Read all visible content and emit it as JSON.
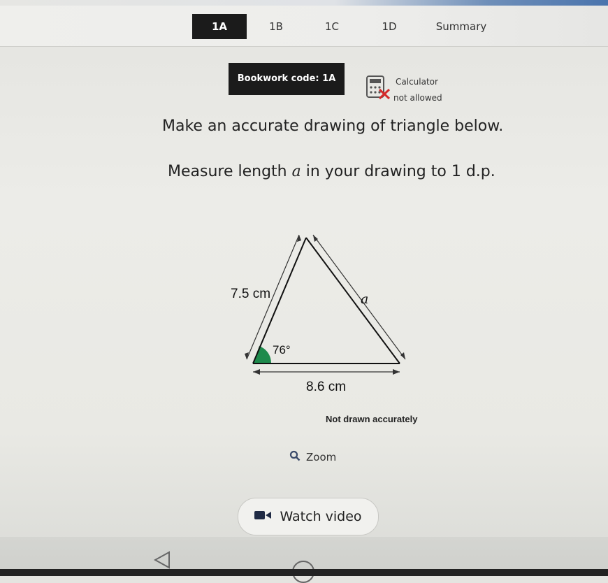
{
  "tabs": [
    {
      "label": "1A",
      "active": true
    },
    {
      "label": "1B",
      "active": false
    },
    {
      "label": "1C",
      "active": false
    },
    {
      "label": "1D",
      "active": false
    },
    {
      "label": "Summary",
      "active": false
    }
  ],
  "bookwork_label": "Bookwork code: 1A",
  "calculator": {
    "line1": "Calculator",
    "line2": "not allowed"
  },
  "question": {
    "line1": "Make an accurate drawing of triangle below.",
    "line2_prefix": "Measure length ",
    "variable": "a",
    "line2_suffix": " in your drawing to 1 d.p."
  },
  "diagram": {
    "left_side": "7.5 cm",
    "right_side": "a",
    "angle": "76°",
    "base": "8.6 cm",
    "note": "Not drawn accurately",
    "angle_fill": "#1e8a4c"
  },
  "zoom_label": "Zoom",
  "watch_label": "Watch video"
}
